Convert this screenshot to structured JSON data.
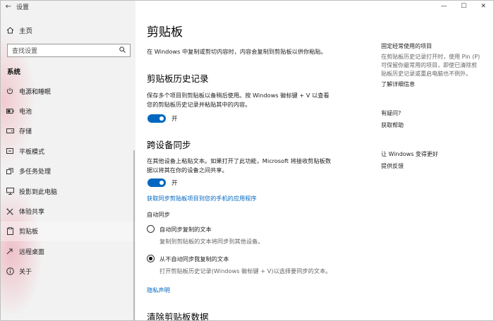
{
  "window": {
    "title": "设置",
    "minimize": "—",
    "maximize": "☐",
    "close": "✕"
  },
  "sidebar": {
    "home": "主页",
    "search_placeholder": "查找设置",
    "section": "系统",
    "items": [
      {
        "label": "电源和睡眠",
        "icon": "power-icon"
      },
      {
        "label": "电池",
        "icon": "battery-icon"
      },
      {
        "label": "存储",
        "icon": "storage-icon"
      },
      {
        "label": "平板模式",
        "icon": "tablet-icon"
      },
      {
        "label": "多任务处理",
        "icon": "multitask-icon"
      },
      {
        "label": "投影到此电脑",
        "icon": "project-icon"
      },
      {
        "label": "体验共享",
        "icon": "share-icon"
      },
      {
        "label": "剪贴板",
        "icon": "clipboard-icon"
      },
      {
        "label": "远程桌面",
        "icon": "remote-icon"
      },
      {
        "label": "关于",
        "icon": "info-icon"
      }
    ]
  },
  "main": {
    "title": "剪贴板",
    "intro": "在 Windows 中复制或剪切内容时，内容会复制到剪贴板以供你粘贴。",
    "history": {
      "heading": "剪贴板历史记录",
      "desc1": "保存多个项目到剪贴板以备稍后使用。按 Windows 徽标键 + V 以查看",
      "desc2": "您的剪贴板历史记录并粘贴其中的内容。",
      "toggle_label": "开"
    },
    "sync": {
      "heading": "跨设备同步",
      "desc1": "在其他设备上粘贴文本。如果打开了此功能，Microsoft 将接收剪贴板数",
      "desc2": "据以将其在你的设备之间共享。",
      "toggle_label": "开",
      "link": "获取同步剪贴板项目到您的手机的应用程序",
      "auto_label": "自动同步",
      "option1": "自动同步复制的文本",
      "option1_desc": "复制到剪贴板的文本将同步到其他设备。",
      "option2": "从不自动同步我复制的文本",
      "option2_desc": "打开剪贴板历史记录(Windows 徽标键 + V)以选择要同步的文本。",
      "privacy": "隐私声明"
    },
    "clear_heading": "清除剪贴板数据"
  },
  "right": {
    "pin_heading": "固定经常使用的项目",
    "pin_desc1": "在剪贴板历史记录打开时，使用 Pin (P)",
    "pin_desc2": "可保留你最常用的项目，即使已清除剪",
    "pin_desc3": "贴板历史记录或重启电脑也不例外。",
    "learn_more": "了解详细信息",
    "question": "有疑问?",
    "get_help": "获取帮助",
    "improve": "让 Windows 变得更好",
    "feedback": "提供反馈"
  }
}
